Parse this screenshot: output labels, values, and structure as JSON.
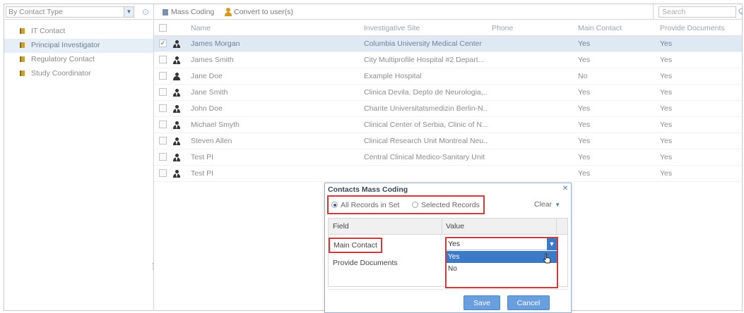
{
  "sidebar": {
    "filter_value": "By Contact Type",
    "items": [
      {
        "label": "IT Contact",
        "selected": false
      },
      {
        "label": "Principal Investigator",
        "selected": true
      },
      {
        "label": "Regulatory Contact",
        "selected": false
      },
      {
        "label": "Study Coordinator",
        "selected": false
      }
    ]
  },
  "toolbar": {
    "mass_coding_label": "Mass Coding",
    "convert_label": "Convert to user(s)",
    "search_placeholder": "Search"
  },
  "grid": {
    "columns": {
      "name": "Name",
      "site": "Investigative Site",
      "phone": "Phone",
      "main_contact": "Main Contact",
      "provide_documents": "Provide Documents"
    },
    "rows": [
      {
        "checked": true,
        "name": "James Morgan",
        "site": "Columbia University Medical Center",
        "phone": "",
        "main_contact": "Yes",
        "provide_documents": "Yes",
        "icon": "pi"
      },
      {
        "checked": false,
        "name": "James Smith",
        "site": "City Multiprofile Hospital #2 Depart...",
        "phone": "",
        "main_contact": "Yes",
        "provide_documents": "Yes",
        "icon": "pi"
      },
      {
        "checked": false,
        "name": "Jane Doe",
        "site": "Example Hospital",
        "phone": "",
        "main_contact": "No",
        "provide_documents": "Yes",
        "icon": "person"
      },
      {
        "checked": false,
        "name": "Jane Smith",
        "site": "Clinica Devila. Depto de Neurologia,...",
        "phone": "",
        "main_contact": "Yes",
        "provide_documents": "Yes",
        "icon": "pi"
      },
      {
        "checked": false,
        "name": "John Doe",
        "site": "Charite Universitatsmedizin Berlin-N...",
        "phone": "",
        "main_contact": "Yes",
        "provide_documents": "Yes",
        "icon": "pi"
      },
      {
        "checked": false,
        "name": "Michael Smyth",
        "site": "Clinical Center of Serbia, Clinic of N...",
        "phone": "",
        "main_contact": "Yes",
        "provide_documents": "Yes",
        "icon": "pi"
      },
      {
        "checked": false,
        "name": "Steven Allen",
        "site": "Clinical Research Unit Montreal Neu...",
        "phone": "",
        "main_contact": "Yes",
        "provide_documents": "Yes",
        "icon": "pi"
      },
      {
        "checked": false,
        "name": "Test PI",
        "site": "Central Clinical Medico-Sanitary Unit",
        "phone": "",
        "main_contact": "Yes",
        "provide_documents": "Yes",
        "icon": "pi"
      },
      {
        "checked": false,
        "name": "Test PI",
        "site": "",
        "phone": "",
        "main_contact": "Yes",
        "provide_documents": "Yes",
        "icon": "pi"
      }
    ]
  },
  "dialog": {
    "title": "Contacts Mass Coding",
    "scope_all_label": "All Records in Set",
    "scope_selected_label": "Selected Records",
    "clear_label": "Clear",
    "field_header": "Field",
    "value_header": "Value",
    "fields": [
      {
        "label": "Main Contact"
      },
      {
        "label": "Provide Documents"
      }
    ],
    "value_current": "Yes",
    "options": [
      "Yes",
      "No"
    ],
    "save_label": "Save",
    "cancel_label": "Cancel"
  },
  "colors": {
    "accent": "#3b7ac6",
    "highlight_border": "#cf3a3a",
    "selected_row": "#dfe9f4"
  }
}
